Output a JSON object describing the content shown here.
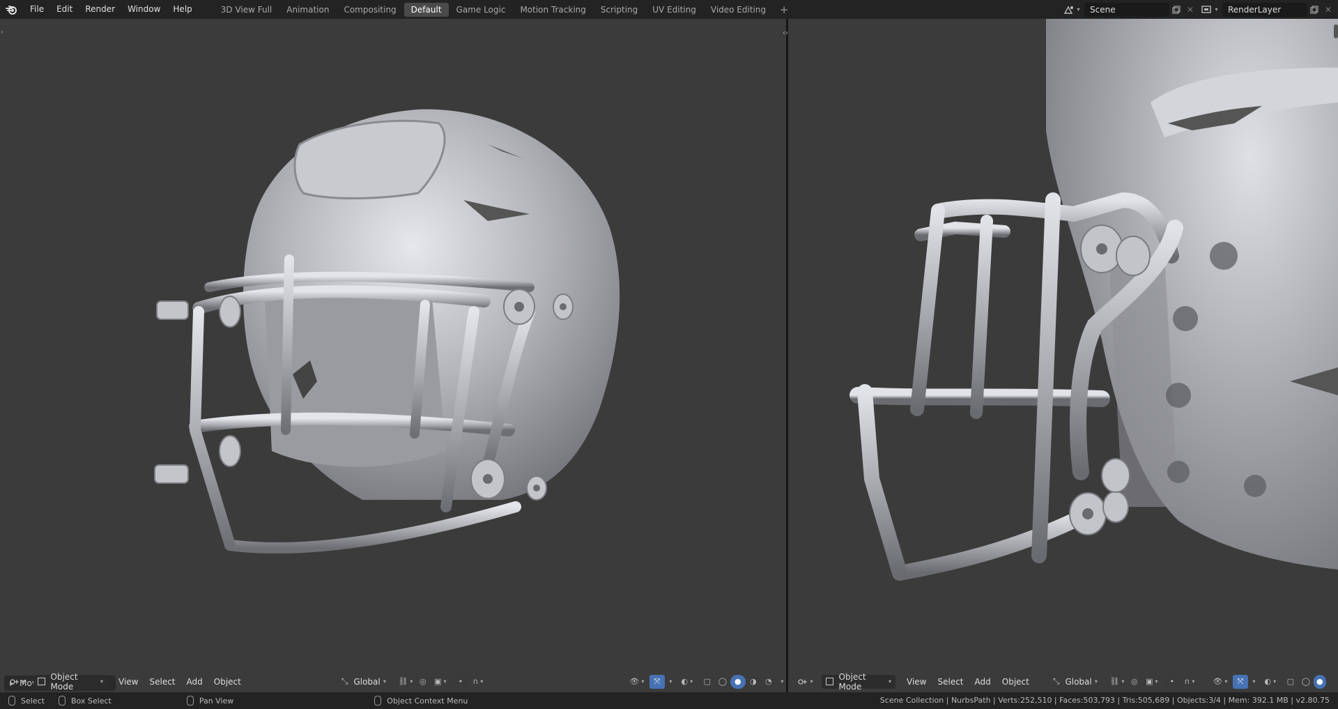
{
  "menu": [
    "File",
    "Edit",
    "Render",
    "Window",
    "Help"
  ],
  "workspaces": [
    "3D View Full",
    "Animation",
    "Compositing",
    "Default",
    "Game Logic",
    "Motion Tracking",
    "Scripting",
    "UV Editing",
    "Video Editing"
  ],
  "active_workspace": "Default",
  "scene": {
    "value": "Scene"
  },
  "render_layer": {
    "value": "RenderLayer"
  },
  "viewport_left": {
    "mode": "Object Mode",
    "menus": [
      "View",
      "Select",
      "Add",
      "Object"
    ],
    "orientation": "Global",
    "move_panel": "Move"
  },
  "viewport_right": {
    "mode": "Object Mode",
    "menus": [
      "View",
      "Select",
      "Add",
      "Object"
    ],
    "orientation": "Global"
  },
  "status": {
    "select": "Select",
    "box_select": "Box Select",
    "pan_view": "Pan View",
    "context_menu": "Object Context Menu",
    "stats": "Scene Collection | NurbsPath | Verts:252,510 | Faces:503,793 | Tris:505,689 | Objects:3/4 | Mem: 392.1 MB | v2.80.75"
  },
  "colors": {
    "viewport_bg": "#3b3b3b",
    "accent": "#4772b3",
    "helmet": "#b8b9bf"
  }
}
